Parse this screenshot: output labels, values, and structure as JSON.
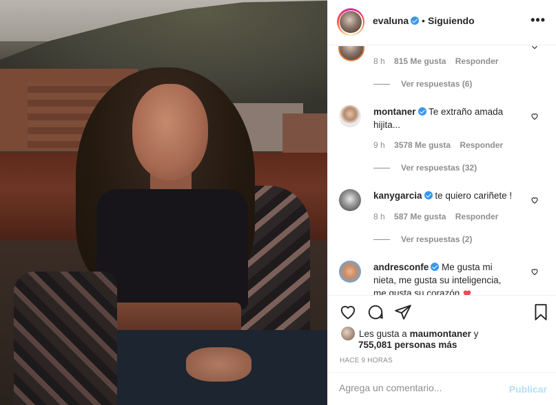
{
  "post": {
    "username": "evaluna",
    "separator": "•",
    "follow_status": "Siguiendo",
    "more_label": "•••"
  },
  "comments": [
    {
      "time": "8 h",
      "likes": "815 Me gusta",
      "reply": "Responder",
      "view_replies": "Ver respuestas (6)"
    },
    {
      "username": "montaner",
      "text_line1": "Te extraño amada",
      "text_line2": "hijita...",
      "time": "9 h",
      "likes": "3578 Me gusta",
      "reply": "Responder",
      "view_replies": "Ver respuestas (32)"
    },
    {
      "username": "kanygarcia",
      "text_line1": "te quiero cariñete !",
      "time": "8 h",
      "likes": "587 Me gusta",
      "reply": "Responder",
      "view_replies": "Ver respuestas (2)"
    },
    {
      "username": "andresconfe",
      "text_line1": "Me gusta mi",
      "text_line2": "nieta, me gusta su inteligencia,",
      "text_line3": "me gusta su corazón"
    }
  ],
  "likes": {
    "prefix": "Les gusta a",
    "user": "maumontaner",
    "conj": "y",
    "others": "755,081 personas más"
  },
  "timestamp": "HACE 9 HORAS",
  "comment_box": {
    "placeholder": "Agrega un comentario...",
    "publish_label": "Publicar"
  },
  "colors": {
    "verified": "#3897f0",
    "publish_disabled": "#b2dffc",
    "heart": "#ed4956",
    "secondary_text": "#8e8e8e"
  }
}
